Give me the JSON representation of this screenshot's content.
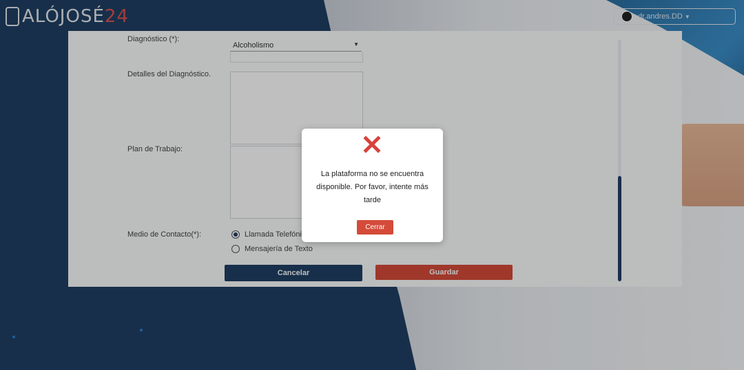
{
  "header": {
    "logo_text": "ALÓJOSÉ",
    "logo_number": "24",
    "user_label": "dr.andres.DD"
  },
  "form": {
    "diagnostico_label": "Diagnóstico (*):",
    "diagnostico_value": "Alcoholismo",
    "detalles_label": "Detalles del Diagnóstico.",
    "plan_label": "Plan de Trabajo:",
    "medio_label": "Medio de Contacto(*):",
    "medio_options": [
      "Llamada Telefónica",
      "Mensajería de Texto"
    ],
    "cancel_label": "Cancelar",
    "save_label": "Guardar"
  },
  "modal": {
    "message": "La plataforma no se encuentra disponible. Por favor, intente más tarde",
    "close_label": "Cerrar"
  },
  "colors": {
    "navy": "#1f3f63",
    "danger": "#d44b3a"
  }
}
